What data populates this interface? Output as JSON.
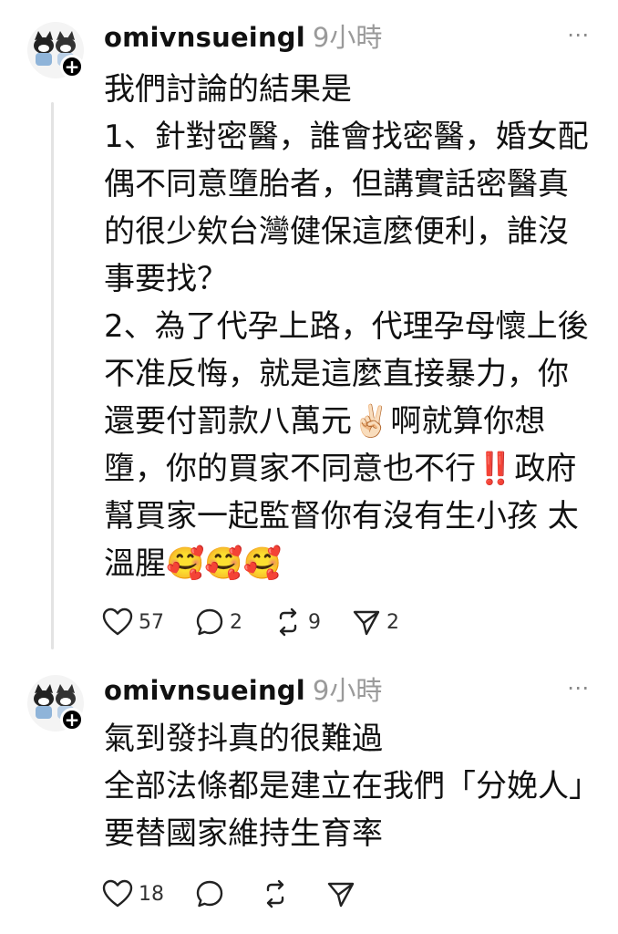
{
  "posts": [
    {
      "username": "omivnsueingl",
      "time": "9小時",
      "more": "⋯",
      "content": "我們討論的結果是\n1、針對密醫，誰會找密醫，婚女配偶不同意墮胎者，但講實話密醫真的很少欸台灣健保這麼便利，誰沒事要找？\n2、為了代孕上路，代理孕母懷上後不准反悔，就是這麼直接暴力，你還要付罰款八萬元✌🏻啊就算你想墮，你的買家不同意也不行‼️政府幫買家一起監督你有沒有生小孩 太溫腥🥰🥰🥰",
      "likes": "57",
      "comments": "2",
      "reposts": "9",
      "shares": "2"
    },
    {
      "username": "omivnsueingl",
      "time": "9小時",
      "more": "⋯",
      "content": "氣到發抖真的很難過\n全部法條都是建立在我們「分娩人」要替國家維持生育率",
      "likes": "18",
      "comments": "",
      "reposts": "",
      "shares": ""
    }
  ],
  "icons": {
    "like": "heart-icon",
    "comment": "speech-bubble-icon",
    "repost": "repost-icon",
    "share": "paper-plane-icon",
    "follow": "plus-icon"
  },
  "colors": {
    "text": "#111111",
    "muted": "#9a9a9a",
    "thread_line": "#e3e3e3",
    "background": "#ffffff"
  }
}
